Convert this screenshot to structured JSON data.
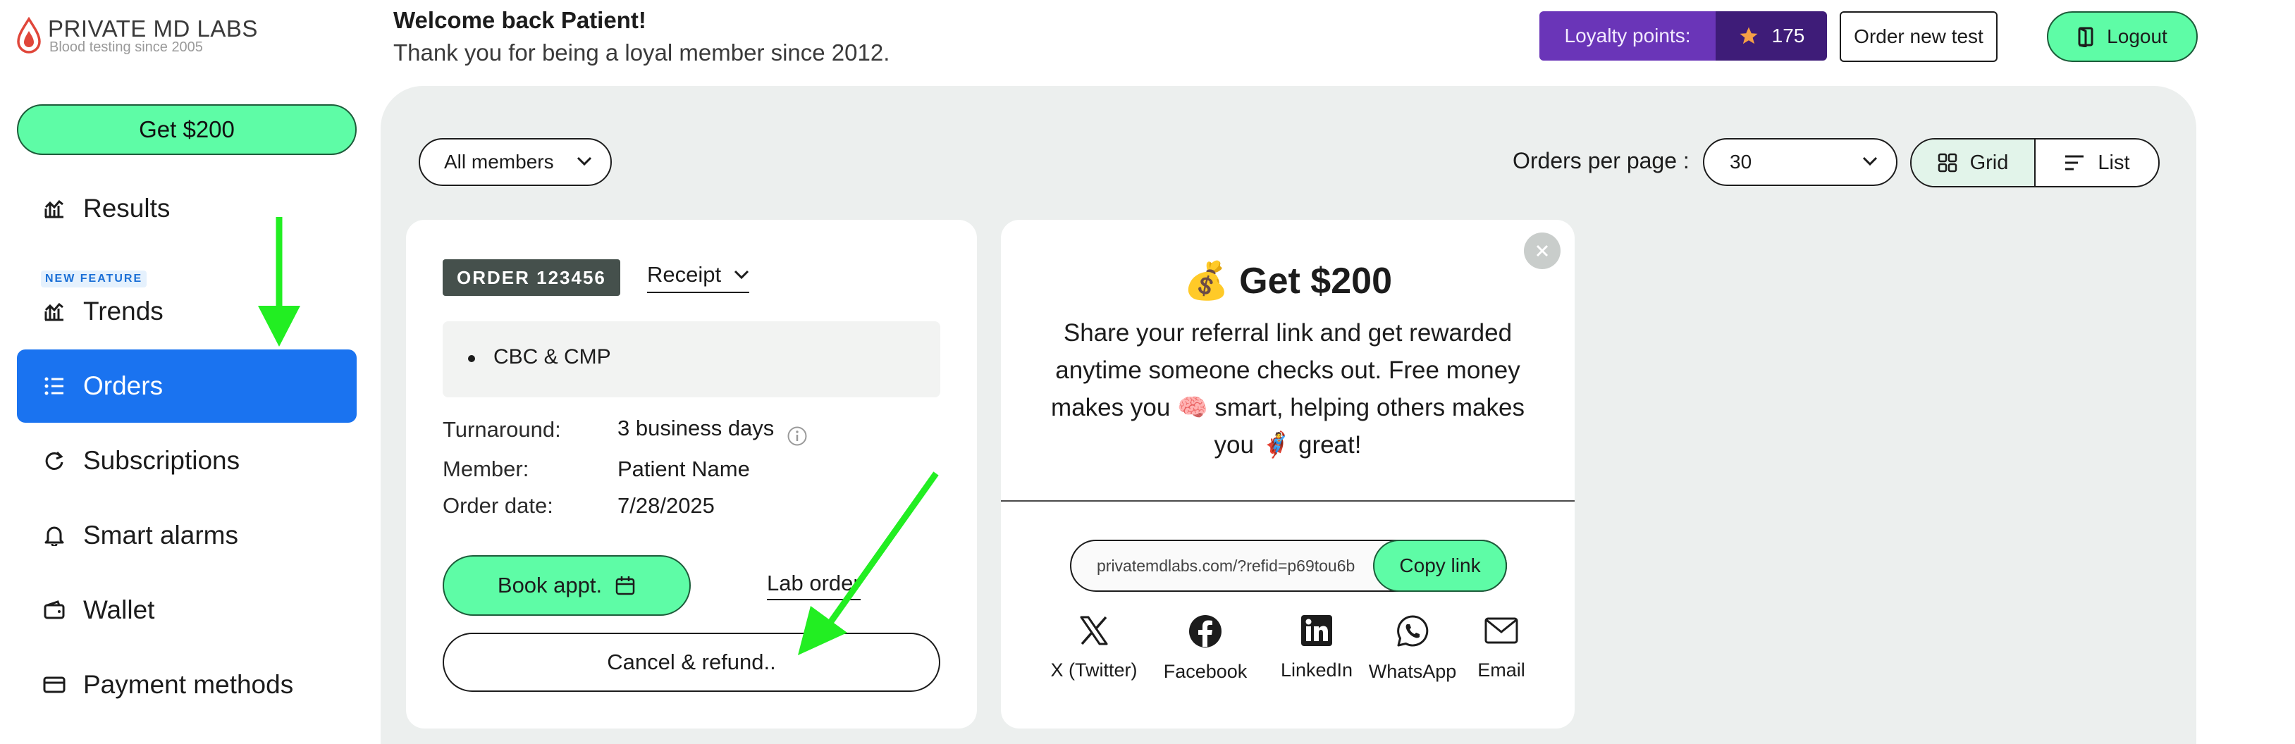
{
  "brand": {
    "name": "PRIVATE MD LABS",
    "tagline": "Blood testing since 2005"
  },
  "sidebar": {
    "cta_label": "Get $200",
    "new_feature_badge": "NEW FEATURE",
    "items": [
      {
        "label": "Results",
        "icon": "chart-icon"
      },
      {
        "label": "Trends",
        "icon": "trend-chart-icon"
      },
      {
        "label": "Orders",
        "icon": "list-icon",
        "active": true
      },
      {
        "label": "Subscriptions",
        "icon": "refresh-icon"
      },
      {
        "label": "Smart alarms",
        "icon": "bell-icon"
      },
      {
        "label": "Wallet",
        "icon": "wallet-icon"
      },
      {
        "label": "Payment methods",
        "icon": "credit-card-icon"
      }
    ]
  },
  "header": {
    "welcome": "Welcome back Patient!",
    "thanks": "Thank you for being a loyal member since 2012.",
    "loyalty_label": "Loyalty points:",
    "loyalty_value": "175",
    "order_new_label": "Order new test",
    "logout_label": "Logout"
  },
  "filters": {
    "members_value": "All members",
    "per_page_label": "Orders per page :",
    "per_page_value": "30",
    "view_grid_label": "Grid",
    "view_list_label": "List",
    "active_view": "Grid"
  },
  "order": {
    "badge": "ORDER 123456",
    "receipt_label": "Receipt",
    "tests": [
      "CBC & CMP"
    ],
    "turnaround_label": "Turnaround:",
    "turnaround_value": "3 business days",
    "member_label": "Member:",
    "member_value": "Patient Name",
    "date_label": "Order date:",
    "date_value": "7/28/2025",
    "book_label": "Book appt.",
    "lab_order_label": "Lab order",
    "cancel_label": "Cancel & refund.."
  },
  "referral": {
    "title": "💰 Get $200",
    "description": "Share your referral link and get rewarded anytime someone checks out. Free money makes you 🧠 smart, helping others makes you 🦸 great!",
    "link": "privatemdlabs.com/?refid=p69tou6b",
    "copy_label": "Copy link",
    "share": [
      {
        "label": "X (Twitter)",
        "icon": "x-twitter-icon"
      },
      {
        "label": "Facebook",
        "icon": "facebook-icon"
      },
      {
        "label": "LinkedIn",
        "icon": "linkedin-icon"
      },
      {
        "label": "WhatsApp",
        "icon": "whatsapp-icon"
      },
      {
        "label": "Email",
        "icon": "email-icon"
      }
    ]
  },
  "colors": {
    "accent_green": "#5efca6",
    "active_blue": "#1a73f0",
    "loyalty_purple": "#6a35b8",
    "loyalty_dark": "#3e1c78",
    "panel_bg": "#ecefee",
    "annotation_arrow": "#22ee22"
  }
}
